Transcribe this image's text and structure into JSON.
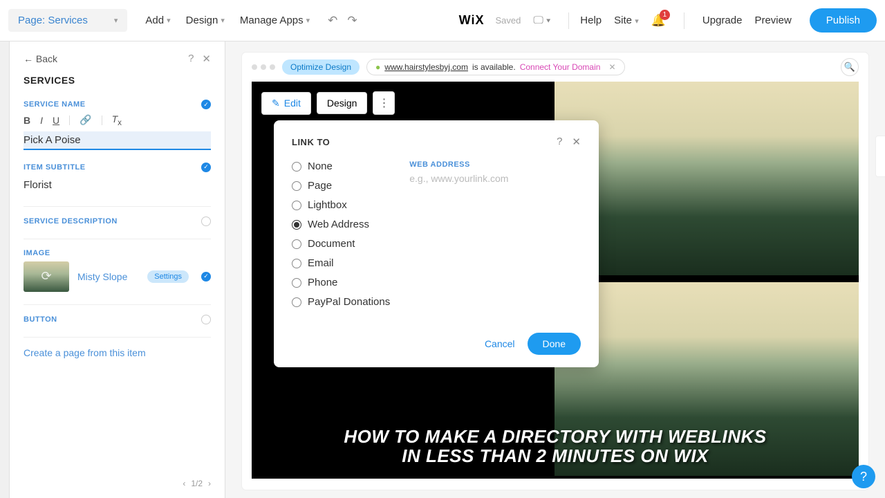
{
  "topbar": {
    "page_selector": "Page: Services",
    "menu": [
      "Add",
      "Design",
      "Manage Apps"
    ],
    "logo": "WiX",
    "saved": "Saved",
    "right_links": [
      "Help",
      "Site"
    ],
    "bell_count": "1",
    "upgrade": "Upgrade",
    "preview": "Preview",
    "publish": "Publish"
  },
  "panel": {
    "back": "← Back",
    "title": "SERVICES",
    "service_name_label": "SERVICE NAME",
    "service_name_value": "Pick A Poise",
    "subtitle_label": "ITEM SUBTITLE",
    "subtitle_value": "Florist",
    "description_label": "SERVICE DESCRIPTION",
    "image_label": "IMAGE",
    "image_name": "Misty Slope",
    "settings": "Settings",
    "button_label": "BUTTON",
    "create_link": "Create a page from this item",
    "pager": "1/2"
  },
  "stage": {
    "optimize": "Optimize Design",
    "domain": "www.hairstylesbyj.com",
    "available": "is available.",
    "connect": "Connect Your Domain",
    "edit": "Edit",
    "design": "Design"
  },
  "modal": {
    "title": "LINK TO",
    "options": [
      "None",
      "Page",
      "Lightbox",
      "Web Address",
      "Document",
      "Email",
      "Phone",
      "PayPal Donations"
    ],
    "selected": "Web Address",
    "addr_label": "WEB ADDRESS",
    "addr_placeholder": "e.g., www.yourlink.com",
    "cancel": "Cancel",
    "done": "Done"
  },
  "caption": "HOW TO MAKE A DIRECTORY WITH WEBLINKS IN LESS THAN 2 MINUTES ON WIX"
}
